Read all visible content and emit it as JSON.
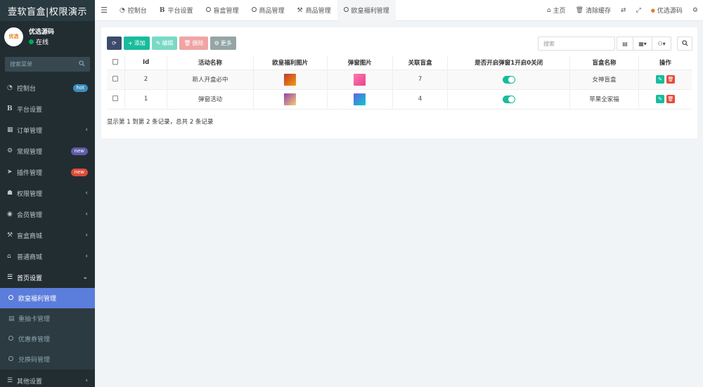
{
  "app": {
    "brand": "壹软盲盒|权限演示"
  },
  "user": {
    "name": "优选源码",
    "status": "在线",
    "avatar_text": "优选"
  },
  "sidebar": {
    "search_placeholder": "搜索菜单",
    "items": [
      {
        "label": "控制台",
        "badge": "hot",
        "icon": "dashboard-icon"
      },
      {
        "label": "平台设置",
        "icon": "bold-b-icon"
      },
      {
        "label": "订单管理",
        "icon": "calculator-icon",
        "chevron": "‹"
      },
      {
        "label": "常规管理",
        "badge": "new",
        "icon": "cogs-icon"
      },
      {
        "label": "插件管理",
        "badge": "new",
        "icon": "rocket-icon"
      },
      {
        "label": "权限管理",
        "icon": "group-icon",
        "chevron": "‹"
      },
      {
        "label": "会员管理",
        "icon": "user-circle-icon",
        "chevron": "‹"
      },
      {
        "label": "盲盒商城",
        "icon": "gavel-icon",
        "chevron": "‹"
      },
      {
        "label": "普通商城",
        "icon": "bank-icon",
        "chevron": "‹"
      },
      {
        "label": "首页设置",
        "icon": "list-icon",
        "chevron": "⌄"
      }
    ],
    "submenu": [
      {
        "label": "欧皇福利管理",
        "icon": "circle-icon",
        "active": true
      },
      {
        "label": "重抽卡管理",
        "icon": "keyboard-icon"
      },
      {
        "label": "优惠券管理",
        "icon": "circle-icon"
      },
      {
        "label": "兑换码管理",
        "icon": "circle-icon"
      }
    ],
    "bottom": {
      "label": "其他设置",
      "icon": "list-icon",
      "chevron": "‹"
    }
  },
  "topnav": {
    "tabs": [
      {
        "label": "控制台",
        "icon": "dashboard-icon"
      },
      {
        "label": "平台设置",
        "icon": "bold-b-icon"
      },
      {
        "label": "盲盒管理",
        "icon": "circle-icon"
      },
      {
        "label": "商品管理",
        "icon": "circle-icon"
      },
      {
        "label": "商品管理",
        "icon": "gavel-icon"
      },
      {
        "label": "欧皇福利管理",
        "icon": "circle-icon",
        "active": true
      }
    ],
    "right": {
      "home": "主页",
      "clear_cache": "清除缓存",
      "user": "优选源码"
    }
  },
  "toolbar": {
    "add": "添加",
    "edit": "编辑",
    "delete": "删除",
    "more": "更多"
  },
  "search": {
    "placeholder": "搜索"
  },
  "table": {
    "columns": [
      "",
      "Id",
      "活动名称",
      "欧皇福利图片",
      "弹窗图片",
      "关联盲盒",
      "是否开启弹窗1开启0关闭",
      "盲盒名称",
      "操作"
    ],
    "rows": [
      {
        "id": "2",
        "name": "新人开盒必中",
        "box_count": "7",
        "popup_on": true,
        "box_name": "女神盲盒",
        "img1_color": "#c0392b",
        "img2_color": "#e84393"
      },
      {
        "id": "1",
        "name": "弹窗活动",
        "box_count": "4",
        "popup_on": true,
        "box_name": "苹果全家福",
        "img1_color": "#8e44ad",
        "img2_color": "#6c5ce7"
      }
    ]
  },
  "summary": "显示第 1 到第 2 条记录，总共 2 条记录"
}
